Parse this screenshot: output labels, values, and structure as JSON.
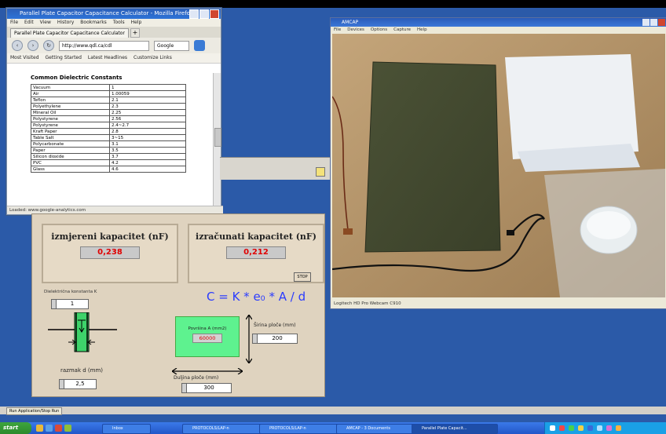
{
  "browser": {
    "title": "Parallel Plate Capacitor Capacitance Calculator - Mozilla Firefox",
    "menu": [
      "File",
      "Edit",
      "View",
      "History",
      "Bookmarks",
      "Tools",
      "Help"
    ],
    "tab_label": "Parallel Plate Capacitor Capacitance Calculator",
    "url": "http://www.qdl.ca/cdl",
    "search_placeholder": "Google",
    "bookmarks": [
      "Most Visited",
      "Getting Started",
      "Latest Headlines",
      "Customize Links"
    ],
    "content_heading": "Common Dielectric Constants",
    "table": [
      [
        "Vacuum",
        "1"
      ],
      [
        "Air",
        "1.00059"
      ],
      [
        "Teflon",
        "2.1"
      ],
      [
        "Polyethylene",
        "2.3"
      ],
      [
        "Mineral Oil",
        "2.25"
      ],
      [
        "Polystyrene",
        "2.56"
      ],
      [
        "Polystyrene",
        "2.4~2.7"
      ],
      [
        "Kraft Paper",
        "2.8"
      ],
      [
        "Table Salt",
        "3~15"
      ],
      [
        "Polycarbonate",
        "3.1"
      ],
      [
        "Paper",
        "3.5"
      ],
      [
        "Silicon dioxide",
        "3.7"
      ],
      [
        "PVC",
        "4.2"
      ],
      [
        "Glass",
        "4.6"
      ]
    ],
    "status": "Loaded: www.google-analytics.com"
  },
  "panel": {
    "measured_title": "izmjereni kapacitet (nF)",
    "measured_value": "0,238",
    "calculated_title": "izračunati kapacitet (nF)",
    "calculated_value": "0,212",
    "stop_label": "STOP",
    "formula": "C = K * e₀ * A / d",
    "k_label": "Dielektrična konstanta K",
    "k_value": "1",
    "area_label": "Površina A (mm2)",
    "area_value": "60000",
    "width_label": "Širina ploče (mm)",
    "width_value": "200",
    "length_label": "Duljina ploče (mm)",
    "length_value": "300",
    "distance_label": "razmak d (mm)",
    "distance_value": "2,5"
  },
  "camera": {
    "title": "AMCAP",
    "menu": [
      "File",
      "Devices",
      "Options",
      "Capture",
      "Help"
    ],
    "status": "Logitech HD Pro Webcam C910"
  },
  "app_strip_tab": "Run Application/Stop Run",
  "taskbar": {
    "start": "start",
    "buttons": [
      "Inbox",
      "PROTOCOLS/LAP-n",
      "PROTOCOLS/LAP-n",
      "AMCAP - 3 Documents",
      "Parallel Plate Capacit..."
    ],
    "active_index": 4
  },
  "colors": {
    "desktop": "#2b5aa8",
    "panel_bg": "#dfd3bf",
    "value_red": "#e00000",
    "formula_blue": "#2a3bff",
    "area_green": "#5ef28f"
  }
}
